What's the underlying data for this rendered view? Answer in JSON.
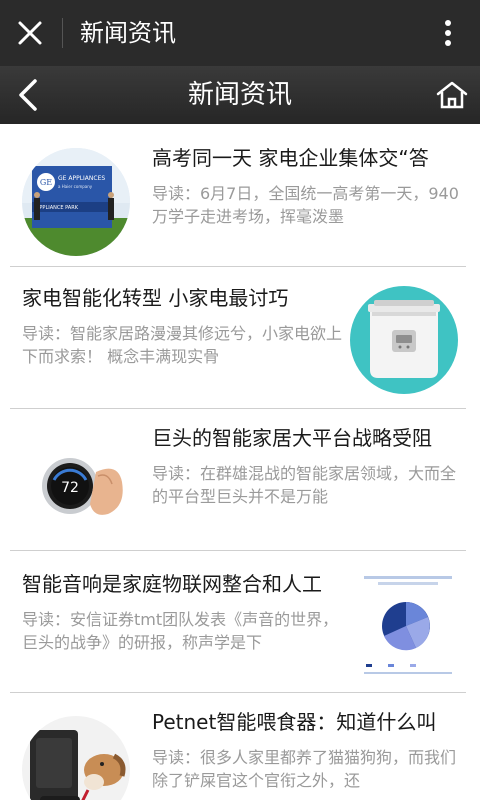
{
  "topbar": {
    "title": "新闻资讯"
  },
  "header": {
    "title": "新闻资讯"
  },
  "articles": [
    {
      "title": "高考同一天 家电企业集体交“答",
      "summary": "导读：6月7日，全国统一高考第一天，940万学子走进考场，挥毫泼墨",
      "image_text_1": "GE APPLIANCES",
      "image_text_2": "a Haier company",
      "image_text_3": "APPLIANCE PARK"
    },
    {
      "title": "家电智能化转型 小家电最讨巧",
      "summary": "导读：智能家居路漫漫其修远兮，小家电欲上下而求索！     概念丰满现实骨"
    },
    {
      "title": "巨头的智能家居大平台战略受阻",
      "summary": "导读：在群雄混战的智能家居领域，大而全的平台型巨头并不是万能",
      "thermostat_value": "72"
    },
    {
      "title": "智能音响是家庭物联网整合和人工",
      "summary": "导读：安信证券tmt团队发表《声音的世界，巨头的战争》的研报，称声学是下"
    },
    {
      "title": "Petnet智能喂食器：知道什么叫",
      "summary": "导读：很多人家里都养了猫猫狗狗，而我们除了铲屎官这个官衔之外，还"
    }
  ],
  "colors": {
    "topbar": "#2b2b2b",
    "divider": "#cfcfcf",
    "summary": "#9a9a9a"
  }
}
